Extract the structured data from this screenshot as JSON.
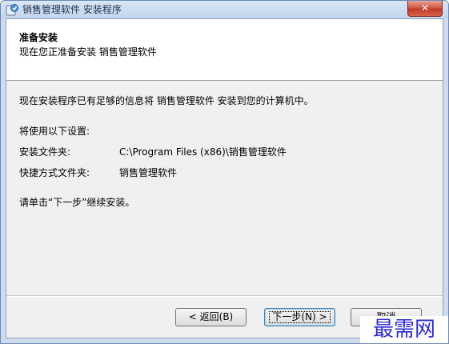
{
  "window": {
    "title": "销售管理软件 安装程序"
  },
  "header": {
    "title": "准备安装",
    "subtitle": "现在您正准备安装 销售管理软件"
  },
  "content": {
    "intro": "现在安装程序已有足够的信息将 销售管理软件 安装到您的计算机中。",
    "settings_heading": "将使用以下设置:",
    "install_folder_label": "安装文件夹:",
    "install_folder_value": "C:\\Program Files (x86)\\销售管理软件",
    "shortcut_folder_label": "快捷方式文件夹:",
    "shortcut_folder_value": "销售管理软件",
    "instruction": "请单击“下一步”继续安装。"
  },
  "buttons": {
    "back": "< 返回(B)",
    "next": "下一步(N) >",
    "cancel": "取消"
  },
  "watermark": "最需网"
}
